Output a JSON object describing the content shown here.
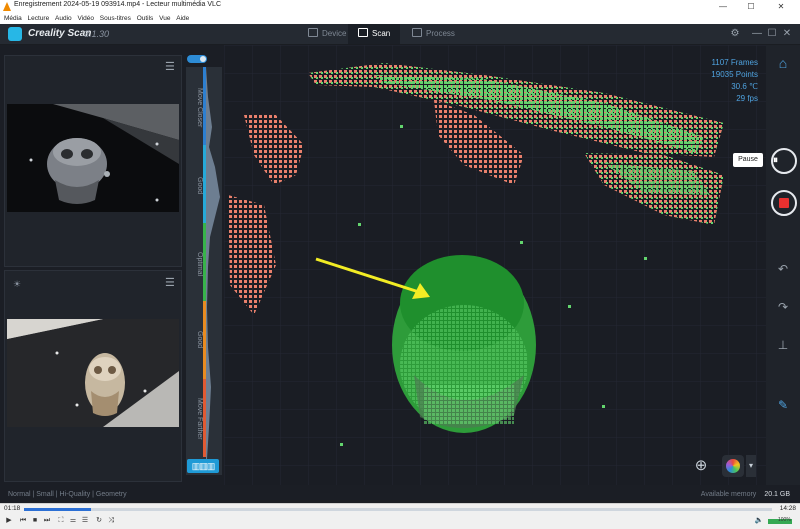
{
  "vlc": {
    "title": "Enregistrement 2024-05-19 093914.mp4 - Lecteur multimédia VLC",
    "menu": [
      "Média",
      "Lecture",
      "Audio",
      "Vidéo",
      "Sous-titres",
      "Outils",
      "Vue",
      "Aide"
    ],
    "time_current": "01:18",
    "time_total": "14:28",
    "progress": 0.09,
    "volume_text": "100%",
    "volume": 1.0
  },
  "app": {
    "name": "Creality Scan",
    "version": "3.1.30",
    "tabs": [
      {
        "label": "Device",
        "active": false
      },
      {
        "label": "Scan",
        "active": true
      },
      {
        "label": "Process",
        "active": false
      }
    ]
  },
  "gauge": {
    "zones": [
      {
        "label": "Move Closer",
        "color": "#2d7fd0"
      },
      {
        "label": "Good",
        "color": "#26a9d8"
      },
      {
        "label": "Optimal",
        "color": "#37b34a"
      },
      {
        "label": "Good",
        "color": "#e88b20"
      },
      {
        "label": "Move Farther",
        "color": "#e05a33"
      }
    ],
    "ruler_glyph": "▥▥▥"
  },
  "stats": {
    "frames": "1107 Frames",
    "points": "19035 Points",
    "temperature": "30.6 ℃",
    "fps": "29 fps"
  },
  "tooltip": {
    "pause": "Pause"
  },
  "status": {
    "mode": "Normal | Small | Hi-Quality | Geometry",
    "memory_label": "Available memory",
    "memory_value": "20.1 GB"
  },
  "icons": {
    "menu": "☰",
    "light": "☀",
    "home": "⌂",
    "undo": "↶",
    "redo": "↷",
    "stamp": "⊥",
    "eraser": "✎",
    "settings": "⚙",
    "minimize": "—",
    "maximize": "☐",
    "close": "✕",
    "pause": "⏸",
    "target": "⊕",
    "caret": "▾",
    "play": "▶",
    "prev": "⏮",
    "stop": "■",
    "next": "⏭",
    "fullscreen": "⛶",
    "playlist": "☰",
    "loop": "↻",
    "shuffle": "⤨",
    "extended": "⚌",
    "frame": "⎘",
    "ab": "⇋",
    "speaker": "🔈"
  },
  "colors": {
    "accent": "#2d8cd6",
    "cloud_green": "#2e9c3a",
    "cloud_pink": "#e9806c",
    "arrow": "#f2ec24"
  }
}
